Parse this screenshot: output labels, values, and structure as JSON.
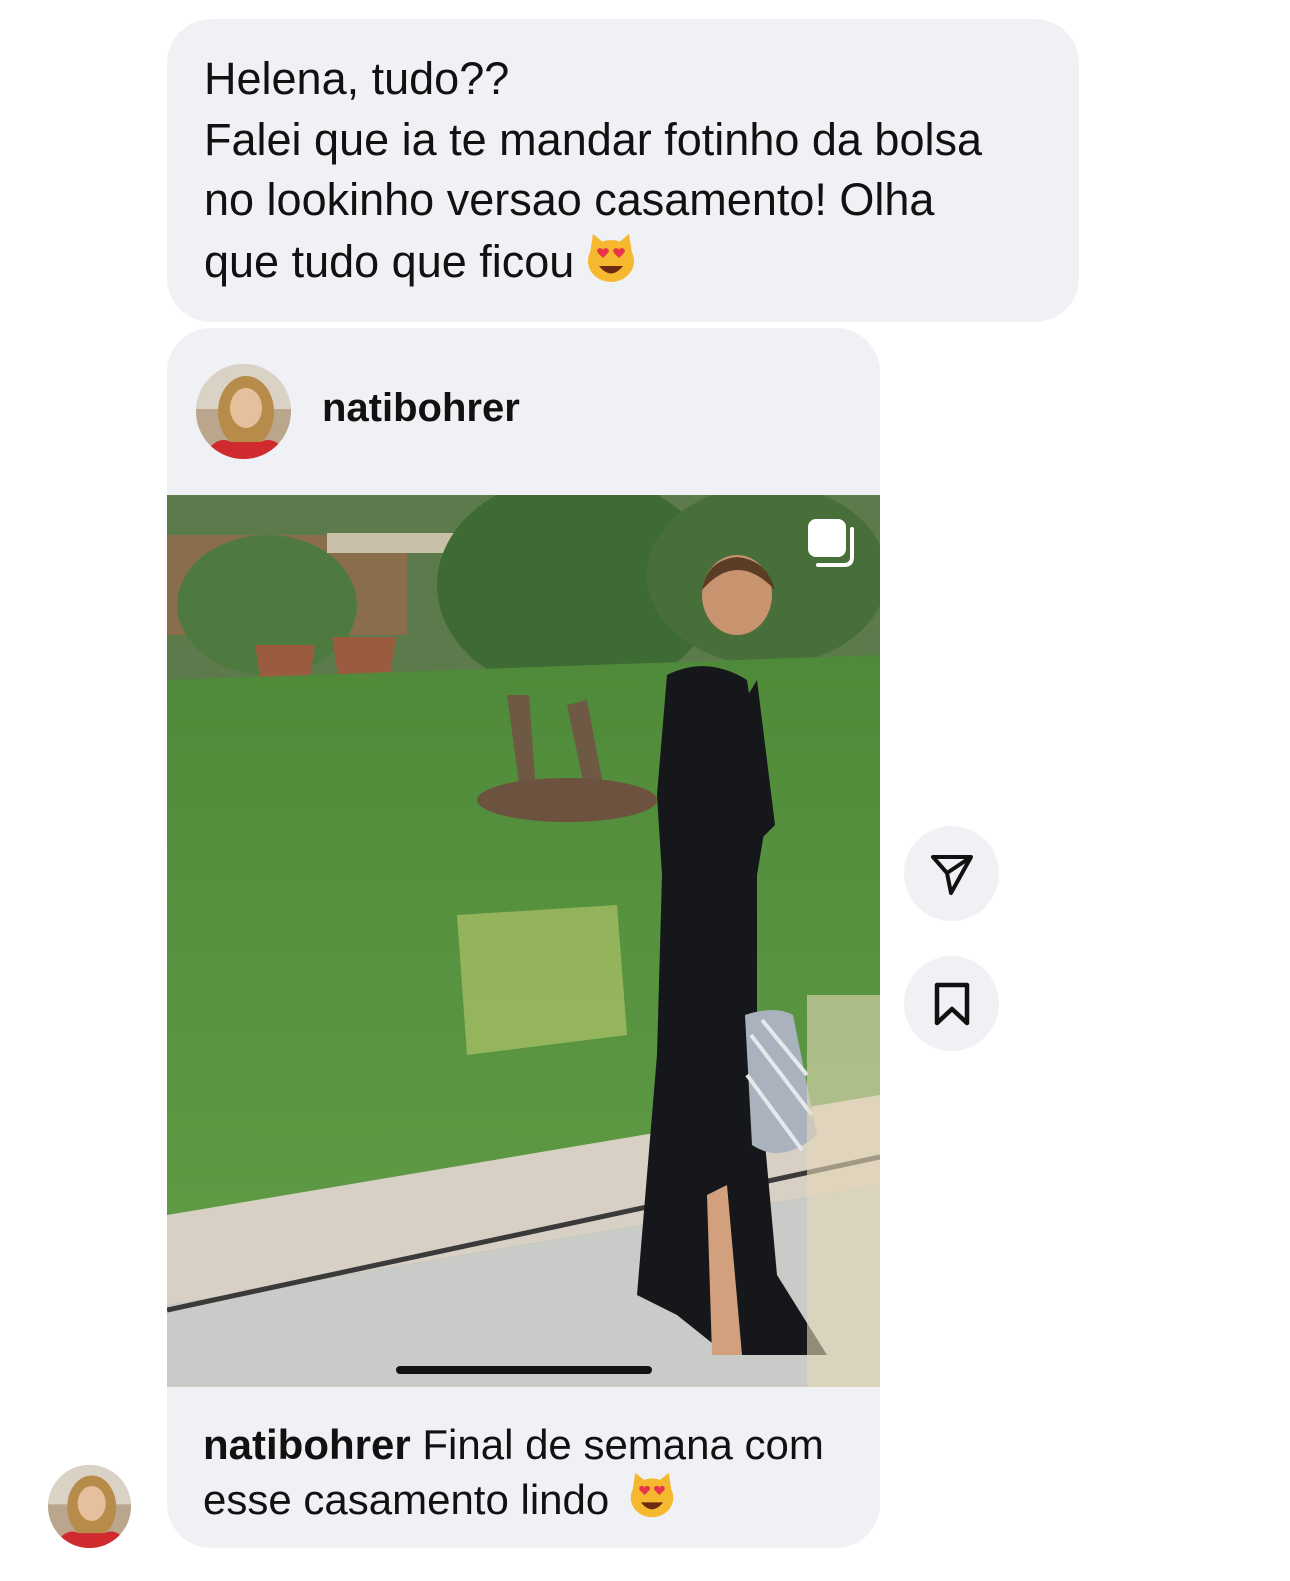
{
  "message": {
    "line1": "Helena, tudo??",
    "line2": "Falei que ia te mandar fotinho da bolsa",
    "line3": "no lookinho versao casamento! Olha",
    "line4": "que tudo que ficou",
    "emoji": "heart-eyes-cat-emoji"
  },
  "shared_post": {
    "username": "natibohrer",
    "caption_user": "natibohrer",
    "caption_line1": "Final de semana com",
    "caption_line2": "esse casamento lindo",
    "caption_emoji": "heart-eyes-cat-emoji",
    "carousel_icon": "carousel-icon",
    "photo_description_icon": "photo"
  },
  "actions": {
    "share_icon": "paper-plane-icon",
    "save_icon": "bookmark-icon"
  },
  "colors": {
    "bubble": "#f0f1f4",
    "text": "#111111",
    "emoji_face": "#f5b82e",
    "heart": "#e8334a"
  }
}
